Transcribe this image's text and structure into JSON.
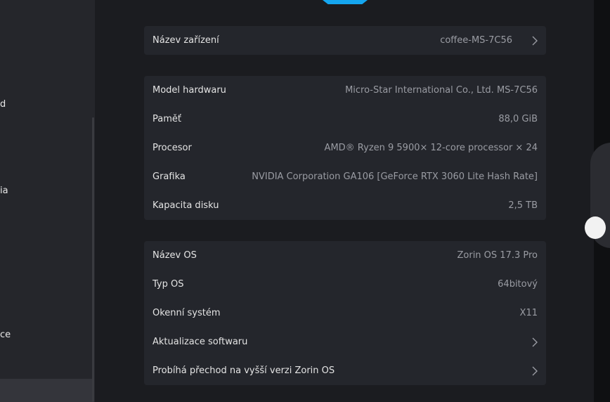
{
  "sidebar": {
    "visible_fragments": [
      "d",
      "ia",
      "ce"
    ]
  },
  "groups": {
    "device": {
      "rows": [
        {
          "label": "Název zařízení",
          "value": "coffee-MS-7C56"
        }
      ]
    },
    "hardware": {
      "rows": [
        {
          "label": "Model hardwaru",
          "value": "Micro-Star International Co., Ltd. MS-7C56"
        },
        {
          "label": "Paměť",
          "value": "88,0 GiB"
        },
        {
          "label": "Procesor",
          "value": "AMD® Ryzen 9 5900× 12-core processor × 24"
        },
        {
          "label": "Grafika",
          "value": "NVIDIA Corporation GA106 [GeForce RTX 3060 Lite Hash Rate]"
        },
        {
          "label": "Kapacita disku",
          "value": "2,5 TB"
        }
      ]
    },
    "os": {
      "rows": [
        {
          "label": "Název OS",
          "value": "Zorin OS 17.3 Pro"
        },
        {
          "label": "Typ OS",
          "value": "64bitový"
        },
        {
          "label": "Okenní systém",
          "value": "X11"
        },
        {
          "label": "Aktualizace softwaru"
        },
        {
          "label": "Probíhá přechod na vyšší verzi Zorin OS"
        }
      ]
    }
  },
  "colors": {
    "accent": "#15a6f0",
    "background": "#1b1c20",
    "group_background": "#24262c",
    "sidebar_background": "#25262b"
  }
}
